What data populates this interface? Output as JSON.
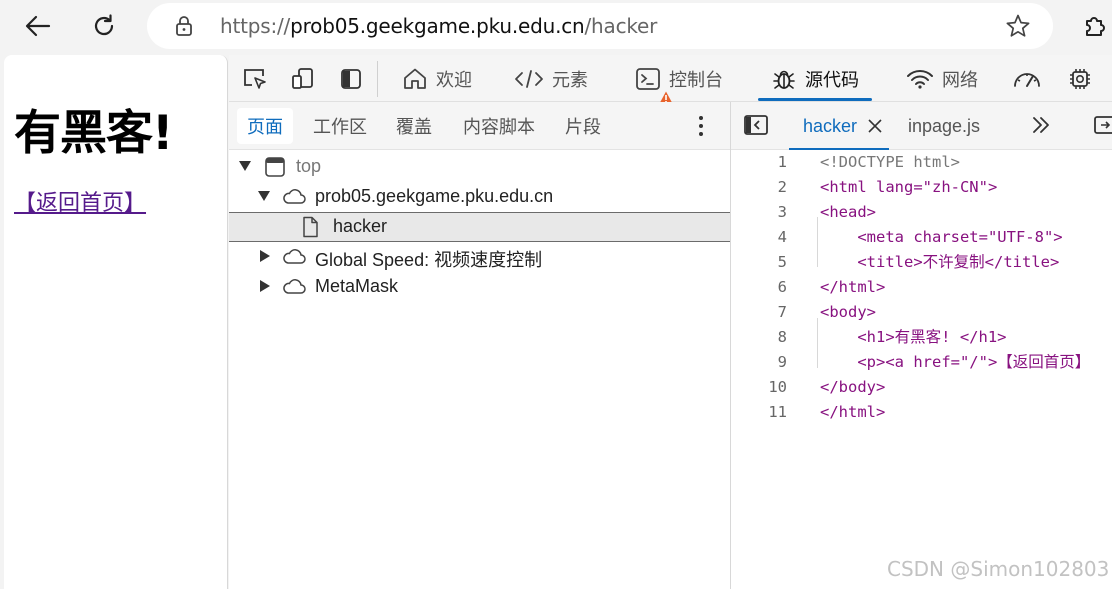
{
  "browser": {
    "url_scheme": "https://",
    "url_host": "prob05.geekgame.pku.edu.cn",
    "url_path": "/hacker",
    "icons": [
      "back-arrow-icon",
      "reload-icon",
      "lock-icon",
      "star-icon",
      "extensions-icon"
    ]
  },
  "page": {
    "heading": "有黑客!",
    "link": "【返回首页】"
  },
  "devtools": {
    "tabs": [
      {
        "label": "欢迎",
        "icon": "home-icon"
      },
      {
        "label": "元素",
        "icon": "code-brackets-icon"
      },
      {
        "label": "控制台",
        "icon": "console-icon"
      },
      {
        "label": "源代码",
        "icon": "bug-icon",
        "active": true
      },
      {
        "label": "网络",
        "icon": "wifi-icon"
      }
    ],
    "toolbar_icons": [
      "inspect-icon",
      "device-emulation-icon",
      "dock-side-icon",
      "performance-icon",
      "settings-gear-icon"
    ],
    "accent": "#0f6cbd",
    "navigator": {
      "tabs": [
        "页面",
        "工作区",
        "覆盖",
        "内容脚本",
        "片段"
      ],
      "active_tab": "页面",
      "tree": [
        {
          "label": "top",
          "icon": "frame-icon",
          "expanded": true
        },
        {
          "label": "prob05.geekgame.pku.edu.cn",
          "icon": "cloud-icon",
          "expanded": true
        },
        {
          "label": "hacker",
          "icon": "file-icon",
          "selected": true
        },
        {
          "label": "Global Speed: 视频速度控制",
          "icon": "cloud-icon",
          "expanded": false
        },
        {
          "label": "MetaMask",
          "icon": "cloud-icon",
          "expanded": false
        }
      ]
    },
    "editor": {
      "tabs": [
        {
          "label": "hacker",
          "active": true
        },
        {
          "label": "inpage.js"
        }
      ],
      "lines": [
        {
          "n": "1",
          "text": "<!DOCTYPE html>"
        },
        {
          "n": "2",
          "text": "<html lang=\"zh-CN\">"
        },
        {
          "n": "3",
          "text": "<head>"
        },
        {
          "n": "4",
          "text": "    <meta charset=\"UTF-8\">"
        },
        {
          "n": "5",
          "text": "    <title>不许复制</title>"
        },
        {
          "n": "6",
          "text": "</html>"
        },
        {
          "n": "7",
          "text": "<body>"
        },
        {
          "n": "8",
          "text": "    <h1>有黑客! </h1>"
        },
        {
          "n": "9",
          "text": "    <p><a href=\"/\">【返回首页】"
        },
        {
          "n": "10",
          "text": "</body>"
        },
        {
          "n": "11",
          "text": "</html>"
        }
      ]
    }
  },
  "watermark": "CSDN @Simon102803"
}
